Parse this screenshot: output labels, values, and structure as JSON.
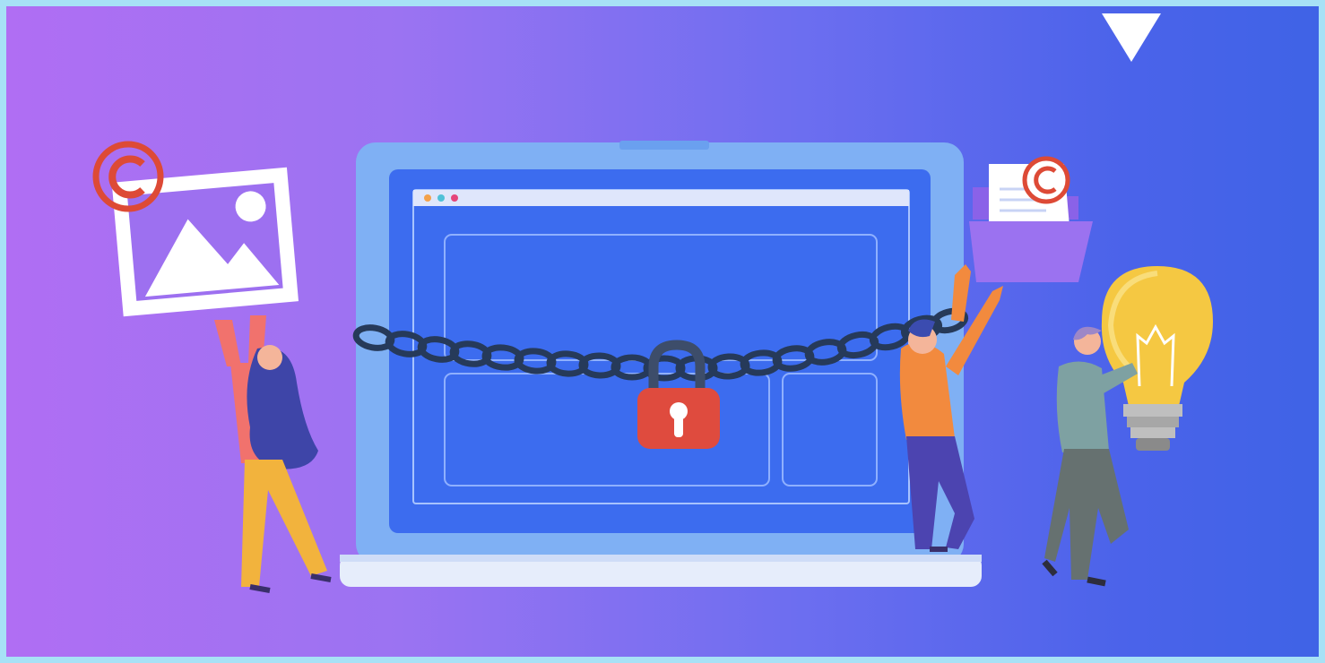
{
  "illustration": {
    "subject": "",
    "icons": [
      "image-icon",
      "copyright-icon",
      "folder-icon",
      "document-icon",
      "padlock-icon",
      "chain-icon",
      "lightbulb-icon",
      "laptop-icon"
    ],
    "colors": {
      "gradient_left": "#b06ef3",
      "gradient_right": "#3f63e6",
      "border": "#a7e1f6",
      "laptop_frame": "#7fb0f4",
      "screen": "#3c6cef",
      "lock": "#df4b3e",
      "copyright": "#dd4a36",
      "bulb": "#f5c842",
      "chain": "#263a5a"
    }
  }
}
